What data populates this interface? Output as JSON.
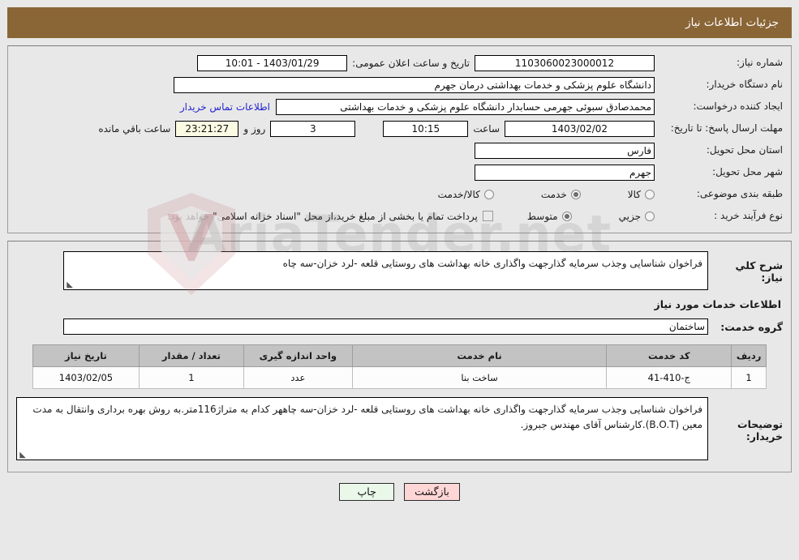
{
  "header": {
    "title": "جزئیات اطلاعات نیاز",
    "bg_color": "#8a6536",
    "text_color": "#ffffff"
  },
  "main_form": {
    "need_number": {
      "label": "شماره نیاز:",
      "value": "1103060023000012"
    },
    "public_announce": {
      "label": "تاریخ و ساعت اعلان عمومی:",
      "value": "1403/01/29 - 10:01"
    },
    "buyer_org": {
      "label": "نام دستگاه خریدار:",
      "value": "دانشگاه علوم پزشکی و خدمات بهداشتی  درمان جهرم"
    },
    "request_creator": {
      "label": "ایجاد کننده درخواست:",
      "value": "محمدصادق  سبوئی جهرمی حسابدار دانشگاه علوم پزشکی و خدمات بهداشتی",
      "contact_link": "اطلاعات تماس خریدار",
      "link_color": "#2323d0"
    },
    "reply_deadline": {
      "label": "مهلت ارسال پاسخ: تا تاریخ:",
      "date": "1403/02/02",
      "time_label": "ساعت",
      "time": "10:15",
      "days": "3",
      "days_sep_label": "روز و",
      "countdown": "23:21:27",
      "countdown_suffix": "ساعت باقي مانده",
      "countdown_bg": "#fbfbe4"
    },
    "delivery_province": {
      "label": "استان محل تحویل:",
      "value": "فارس"
    },
    "delivery_city": {
      "label": "شهر محل تحویل:",
      "value": "جهرم"
    },
    "subject_category": {
      "label": "طبقه بندی موضوعی:",
      "options": [
        "کالا",
        "خدمت",
        "کالا/خدمت"
      ],
      "selected": "خدمت"
    },
    "purchase_process": {
      "label": "نوع فرآیند خرید :",
      "options": [
        "جزیي",
        "متوسط"
      ],
      "selected": "متوسط",
      "checkbox_label": "پرداخت تمام یا بخشی از مبلغ خرید،از محل \"اسناد خزانه اسلامی\" خواهد بود.",
      "checkbox_checked": false
    }
  },
  "body_section": {
    "general_description": {
      "label": "شرح کلي نیاز:",
      "value": "فراخوان شناسایی وجذب سرمایه گذارجهت واگذاری خانه بهداشت های روستایی قلعه -لرد خزان-سه چاه"
    },
    "services_heading": "اطلاعات خدمات مورد نیاز",
    "service_group": {
      "label": "گروه خدمت:",
      "value": "ساختمان"
    },
    "items_table": {
      "columns": [
        "ردیف",
        "کد خدمت",
        "نام خدمت",
        "واحد اندازه گیری",
        "تعداد / مقدار",
        "تاریخ نیاز"
      ],
      "rows": [
        [
          "1",
          "ج-410-41",
          "ساخت بنا",
          "عدد",
          "1",
          "1403/02/05"
        ]
      ]
    },
    "buyer_notes": {
      "label": "توضیحات خریدار:",
      "value": "فراخوان شناسایی وجذب سرمایه گذارجهت واگذاری خانه بهداشت های روستایی قلعه -لرد خزان-سه چاههر کدام به متراژ116متر.به روش بهره برداری وانتقال به مدت معین (B.O.T).کارشناس آقای مهندس جبروز."
    }
  },
  "footer": {
    "print_label": "چاپ",
    "back_label": "بازگشت",
    "print_bg": "#eaf8ea",
    "back_bg": "#ffd6d6"
  },
  "watermark": {
    "text": "AriaTender.net"
  }
}
